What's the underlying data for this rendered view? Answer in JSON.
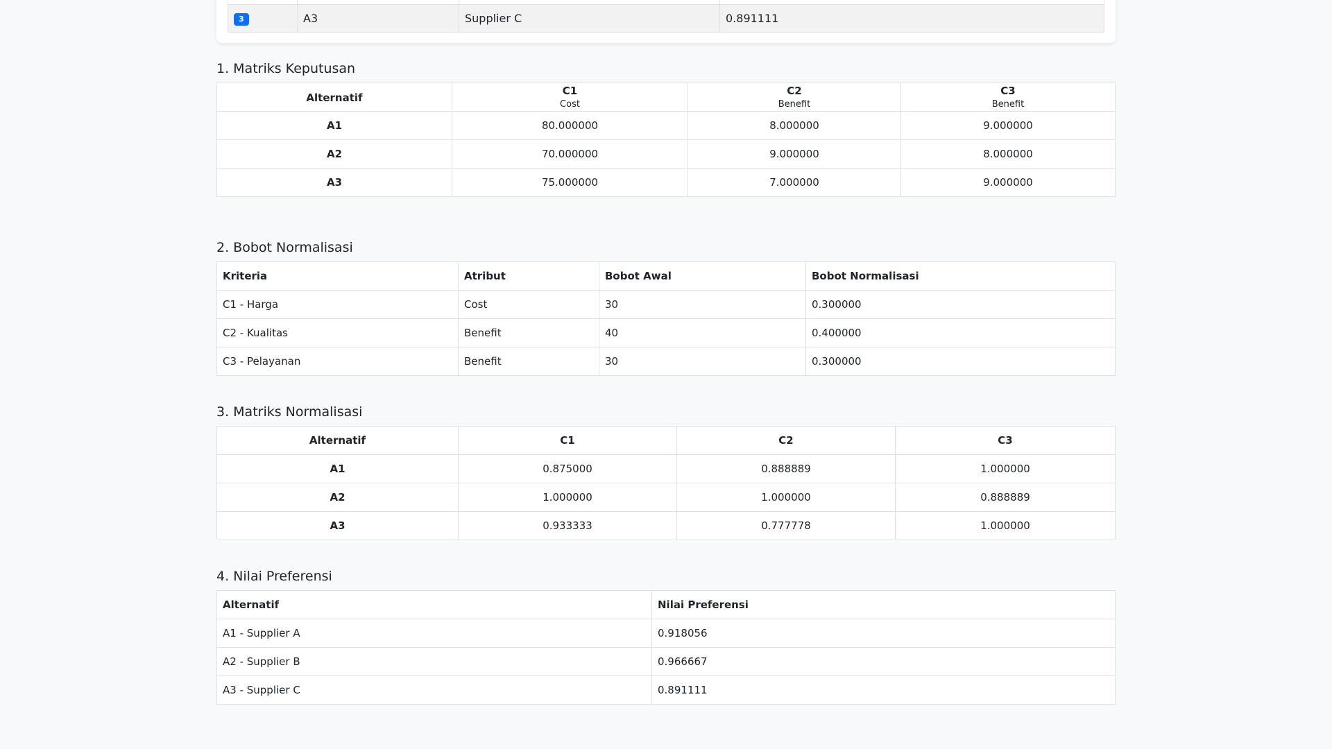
{
  "ranking": {
    "last_row": {
      "rank": "3",
      "alternative": "A3",
      "name": "Supplier C",
      "value": "0.891111"
    }
  },
  "sections": {
    "decision_matrix": {
      "title": "1. Matriks Keputusan",
      "headers": {
        "alt": "Alternatif",
        "c1": "C1",
        "c1_type": "Cost",
        "c2": "C2",
        "c2_type": "Benefit",
        "c3": "C3",
        "c3_type": "Benefit"
      },
      "rows": [
        [
          "A1",
          "80.000000",
          "8.000000",
          "9.000000"
        ],
        [
          "A2",
          "70.000000",
          "9.000000",
          "8.000000"
        ],
        [
          "A3",
          "75.000000",
          "7.000000",
          "9.000000"
        ]
      ]
    },
    "weights": {
      "title": "2. Bobot Normalisasi",
      "headers": [
        "Kriteria",
        "Atribut",
        "Bobot Awal",
        "Bobot Normalisasi"
      ],
      "rows": [
        [
          "C1 - Harga",
          "Cost",
          "30",
          "0.300000"
        ],
        [
          "C2 - Kualitas",
          "Benefit",
          "40",
          "0.400000"
        ],
        [
          "C3 - Pelayanan",
          "Benefit",
          "30",
          "0.300000"
        ]
      ]
    },
    "normalized": {
      "title": "3. Matriks Normalisasi",
      "headers": [
        "Alternatif",
        "C1",
        "C2",
        "C3"
      ],
      "rows": [
        [
          "A1",
          "0.875000",
          "0.888889",
          "1.000000"
        ],
        [
          "A2",
          "1.000000",
          "1.000000",
          "0.888889"
        ],
        [
          "A3",
          "0.933333",
          "0.777778",
          "1.000000"
        ]
      ]
    },
    "preference": {
      "title": "4. Nilai Preferensi",
      "headers": [
        "Alternatif",
        "Nilai Preferensi"
      ],
      "rows": [
        [
          "A1 - Supplier A",
          "0.918056"
        ],
        [
          "A2 - Supplier B",
          "0.966667"
        ],
        [
          "A3 - Supplier C",
          "0.891111"
        ]
      ]
    }
  },
  "colors": {
    "badge": "#0d6efd",
    "border": "#dee2e6",
    "background": "#f8f9fa"
  }
}
